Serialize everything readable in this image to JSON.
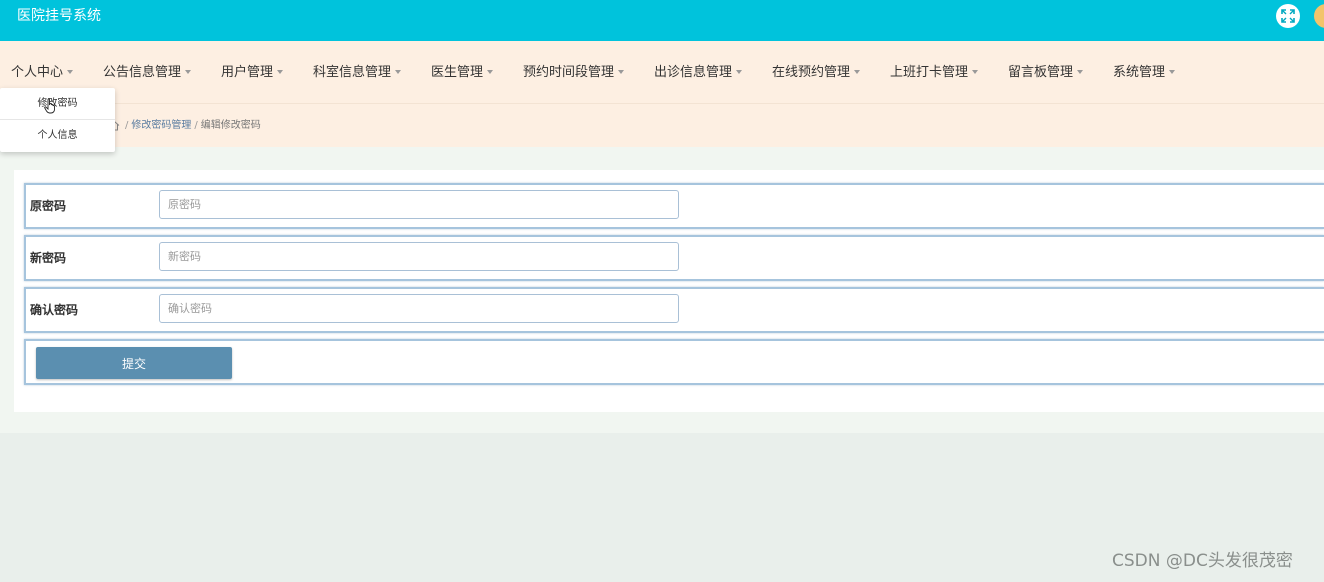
{
  "header": {
    "title": "医院挂号系统",
    "icons": {
      "fullscreen": "fullscreen-icon",
      "avatar": "avatar"
    }
  },
  "nav": {
    "items": [
      {
        "label": "个人中心"
      },
      {
        "label": "公告信息管理"
      },
      {
        "label": "用户管理"
      },
      {
        "label": "科室信息管理"
      },
      {
        "label": "医生管理"
      },
      {
        "label": "预约时间段管理"
      },
      {
        "label": "出诊信息管理"
      },
      {
        "label": "在线预约管理"
      },
      {
        "label": "上班打卡管理"
      },
      {
        "label": "留言板管理"
      },
      {
        "label": "系统管理"
      }
    ],
    "dropdown": {
      "items": [
        {
          "label": "修改密码"
        },
        {
          "label": "个人信息"
        }
      ]
    }
  },
  "breadcrumb": {
    "home_icon": "home-icon",
    "separator": "/",
    "items": [
      "修改密码管理",
      "编辑修改密码"
    ]
  },
  "form": {
    "fields": [
      {
        "label": "原密码",
        "placeholder": "原密码",
        "value": ""
      },
      {
        "label": "新密码",
        "placeholder": "新密码",
        "value": ""
      },
      {
        "label": "确认密码",
        "placeholder": "确认密码",
        "value": ""
      }
    ],
    "submit_label": "提交"
  },
  "watermark": "CSDN @DC头发很茂密",
  "colors": {
    "header_bg": "#00c3dc",
    "nav_bg": "#fdefe2",
    "button_bg": "#5b8fb0",
    "field_border": "#a6c4dd"
  }
}
